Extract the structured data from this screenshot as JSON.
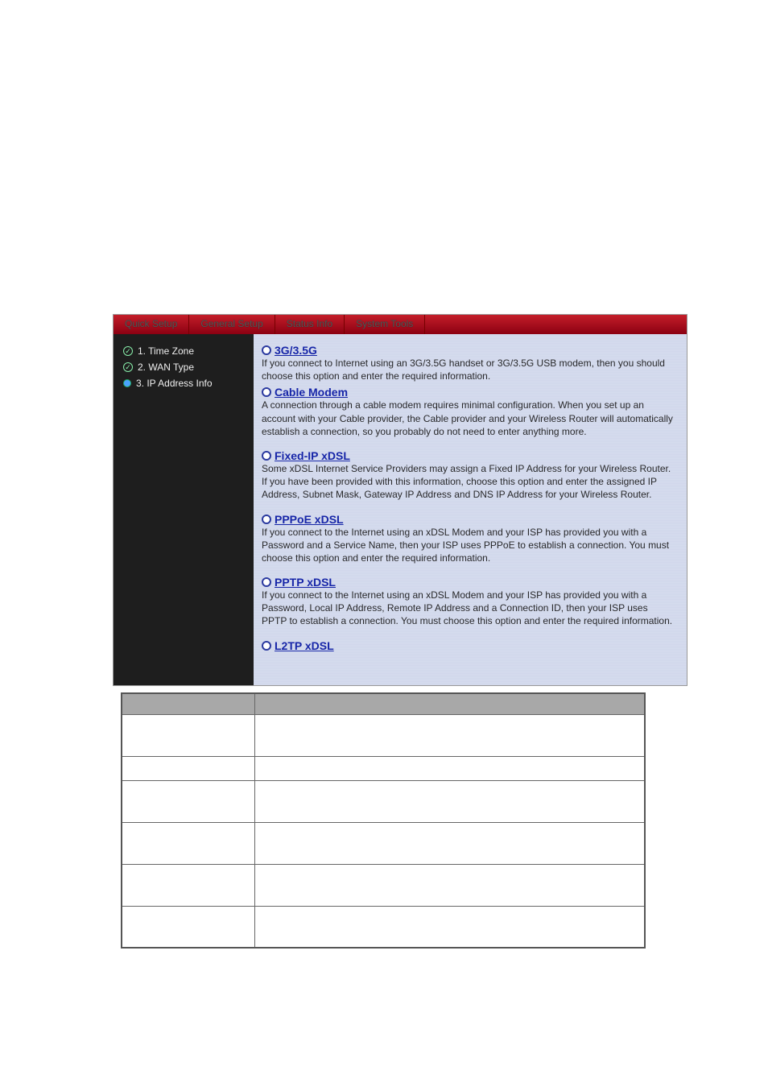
{
  "tabs": {
    "quick_setup": "Quick Setup",
    "general_setup": "General Setup",
    "status_info": "Status Info",
    "system_tools": "System Tools"
  },
  "sidebar": {
    "items": [
      {
        "label": "1. Time Zone",
        "state": "checked"
      },
      {
        "label": "2. WAN Type",
        "state": "checked"
      },
      {
        "label": "3. IP Address Info",
        "state": "active"
      }
    ]
  },
  "options": [
    {
      "title": "3G/3.5G",
      "desc": "If you connect to Internet using an 3G/3.5G handset or 3G/3.5G USB modem, then you should choose this option and enter the required information."
    },
    {
      "title": "Cable Modem",
      "desc": "A connection through a cable modem requires minimal configuration. When you set up an account with your Cable provider, the Cable provider and your Wireless Router will automatically establish a connection, so you probably do not need to enter anything more."
    },
    {
      "title": "Fixed-IP xDSL",
      "desc": "Some xDSL Internet Service Providers may assign a Fixed IP Address for your Wireless Router. If you have been provided with this information, choose this option and enter the assigned IP Address, Subnet Mask, Gateway IP Address and DNS IP Address for your Wireless Router."
    },
    {
      "title": "PPPoE xDSL",
      "desc": "If you connect to the Internet using an xDSL Modem and your ISP has provided you with a Password and a Service Name, then your ISP uses PPPoE to establish a connection. You must choose this option and enter the required information."
    },
    {
      "title": "PPTP xDSL",
      "desc": "If you connect to the Internet using an xDSL Modem and your ISP has provided you with a Password, Local IP Address, Remote IP Address and a Connection ID, then your ISP uses PPTP to establish a connection. You must choose this option and enter the required information."
    },
    {
      "title": "L2TP xDSL",
      "desc": ""
    }
  ],
  "info_table": {
    "headers": [
      "",
      ""
    ],
    "rows": [
      [
        "",
        ""
      ],
      [
        "",
        ""
      ],
      [
        "",
        ""
      ],
      [
        "",
        ""
      ],
      [
        "",
        ""
      ],
      [
        "",
        ""
      ]
    ]
  }
}
